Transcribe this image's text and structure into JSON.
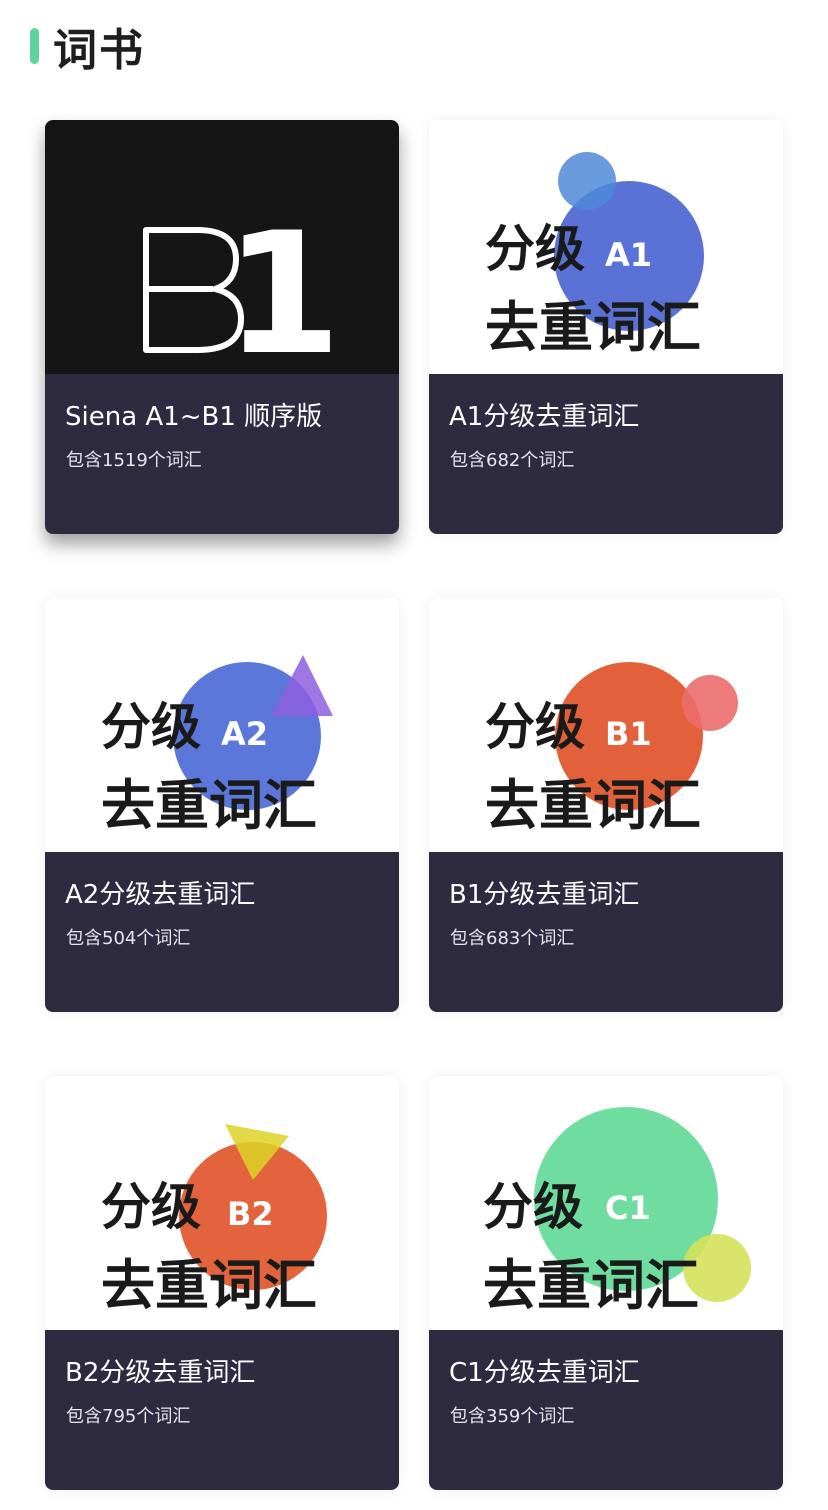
{
  "header": {
    "title": "词书",
    "accent_color": "#5fd49a"
  },
  "books": [
    {
      "name": "Siena A1~B1 顺序版",
      "count": "包含1519个词汇",
      "cover": {
        "style": "dark",
        "label_outline": "B",
        "label_solid": "1"
      }
    },
    {
      "name": "A1分级去重词汇",
      "count": "包含682个词汇",
      "cover": {
        "style": "circles",
        "line1": "分级",
        "level": "A1",
        "line2": "去重词汇",
        "colors": [
          "#4f8ad8",
          "#5a72d6"
        ]
      }
    },
    {
      "name": "A2分级去重词汇",
      "count": "包含504个词汇",
      "cover": {
        "style": "circles",
        "line1": "分级",
        "level": "A2",
        "line2": "去重词汇",
        "colors": [
          "#5b77d9",
          "#8d5fe0"
        ]
      }
    },
    {
      "name": "B1分级去重词汇",
      "count": "包含683个词汇",
      "cover": {
        "style": "circles",
        "line1": "分级",
        "level": "B1",
        "line2": "去重词汇",
        "colors": [
          "#e2613a",
          "#ec6d6d"
        ]
      }
    },
    {
      "name": "B2分级去重词汇",
      "count": "包含795个词汇",
      "cover": {
        "style": "circles",
        "line1": "分级",
        "level": "B2",
        "line2": "去重词汇",
        "colors": [
          "#e3633c",
          "#dcd225"
        ]
      }
    },
    {
      "name": "C1分级去重词汇",
      "count": "包含359个词汇",
      "cover": {
        "style": "circles",
        "line1": "分级",
        "level": "C1",
        "line2": "去重词汇",
        "colors": [
          "#5fd995",
          "#d4e25a"
        ]
      }
    }
  ]
}
